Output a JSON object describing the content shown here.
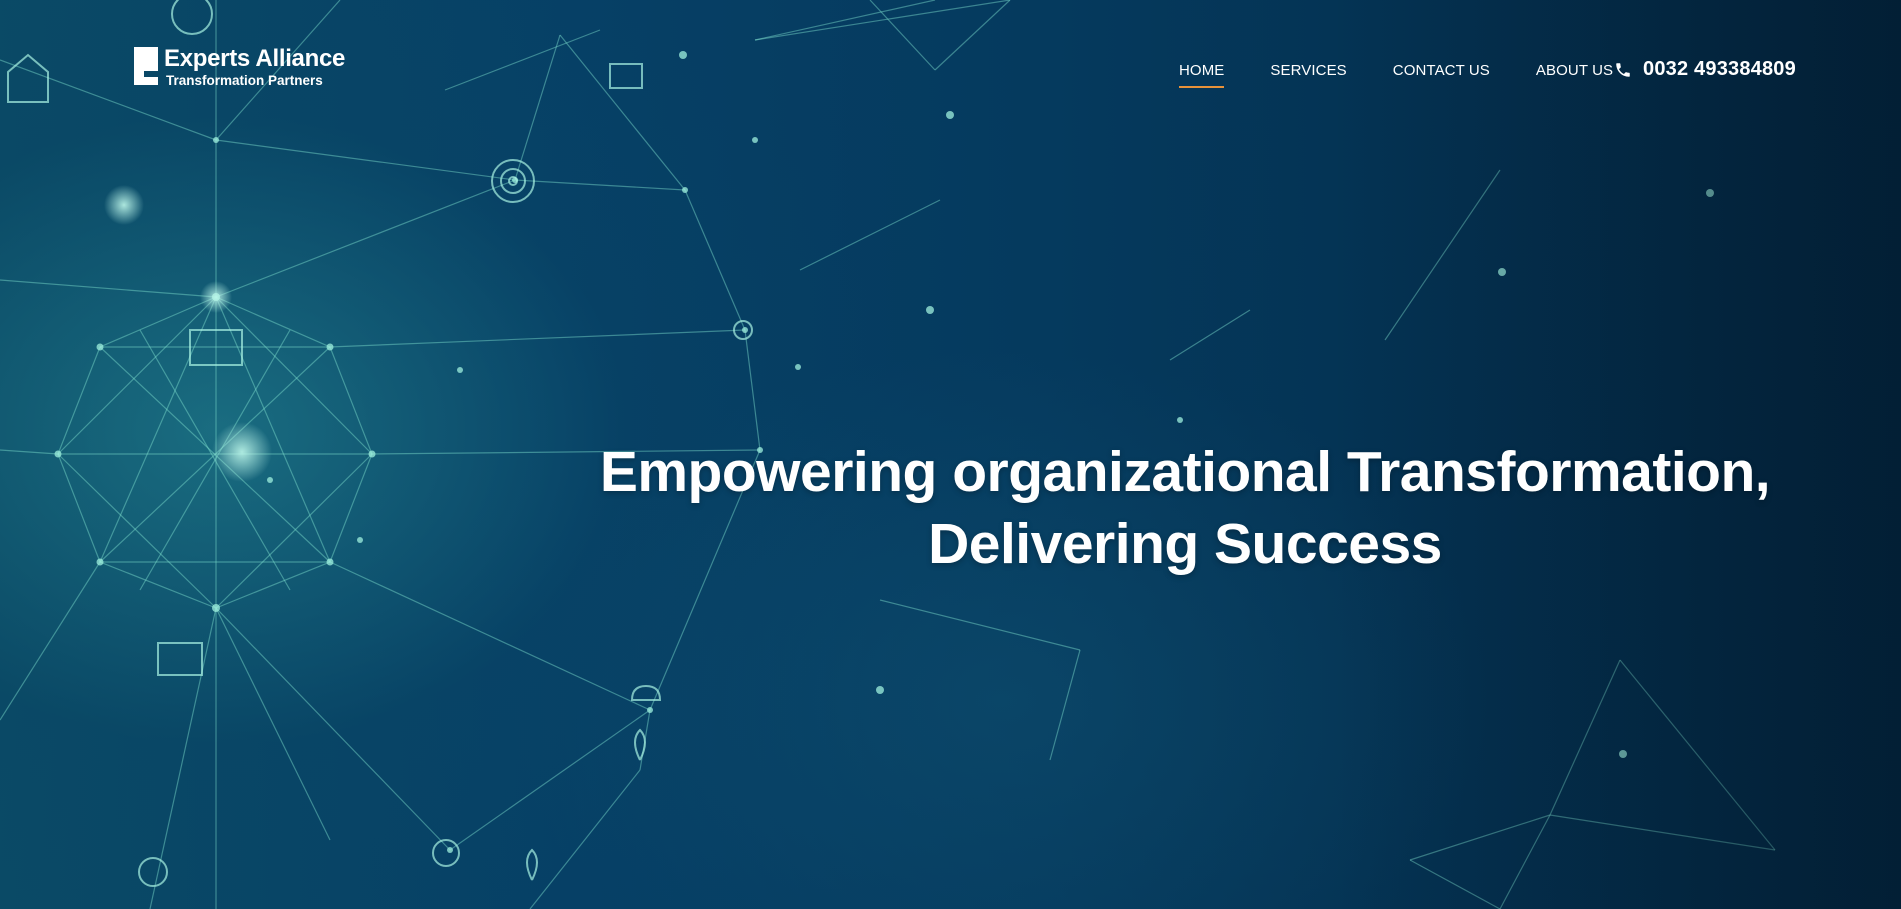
{
  "brand": {
    "name": "Experts Alliance",
    "tagline": "Transformation Partners"
  },
  "nav": {
    "items": [
      {
        "label": "HOME",
        "active": true
      },
      {
        "label": "SERVICES",
        "active": false
      },
      {
        "label": "CONTACT US",
        "active": false
      },
      {
        "label": "ABOUT US",
        "active": false
      }
    ]
  },
  "contact": {
    "icon": "phone-icon",
    "phone": "0032 493384809"
  },
  "hero": {
    "headline_line1": "Empowering organizational Transformation,",
    "headline_line2": "Delivering Success",
    "background": "network-graph-illustration"
  },
  "colors": {
    "accent": "#e8923a",
    "background": "#053150",
    "network_line": "#7fe0cf",
    "text": "#ffffff"
  }
}
